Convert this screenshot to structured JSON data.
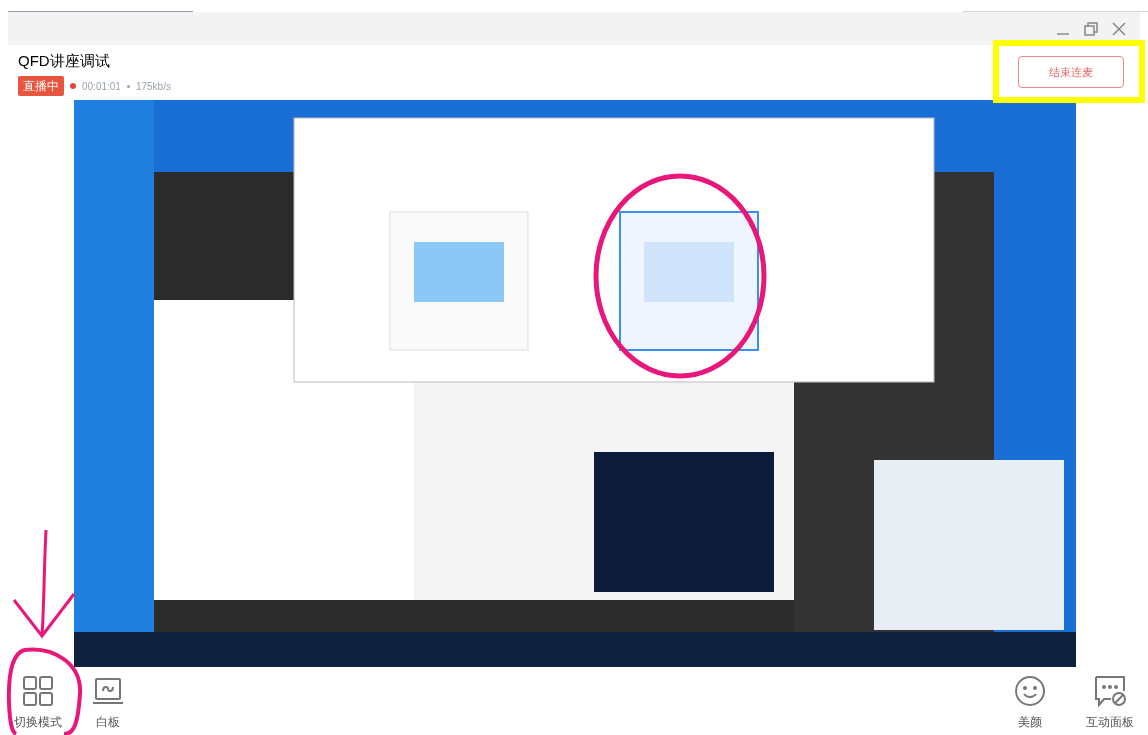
{
  "stream": {
    "title": "QFD讲座调试",
    "live_badge": "直播中",
    "duration": "00:01:01",
    "bitrate": "175kb/s"
  },
  "end_button": "结束连麦",
  "tools_left": [
    {
      "kind": "grid",
      "label": "切换模式"
    },
    {
      "kind": "whiteboard",
      "label": "白板"
    }
  ],
  "tools_right": [
    {
      "kind": "face",
      "label": "美颜"
    },
    {
      "kind": "chat",
      "label": "互动面板"
    }
  ]
}
